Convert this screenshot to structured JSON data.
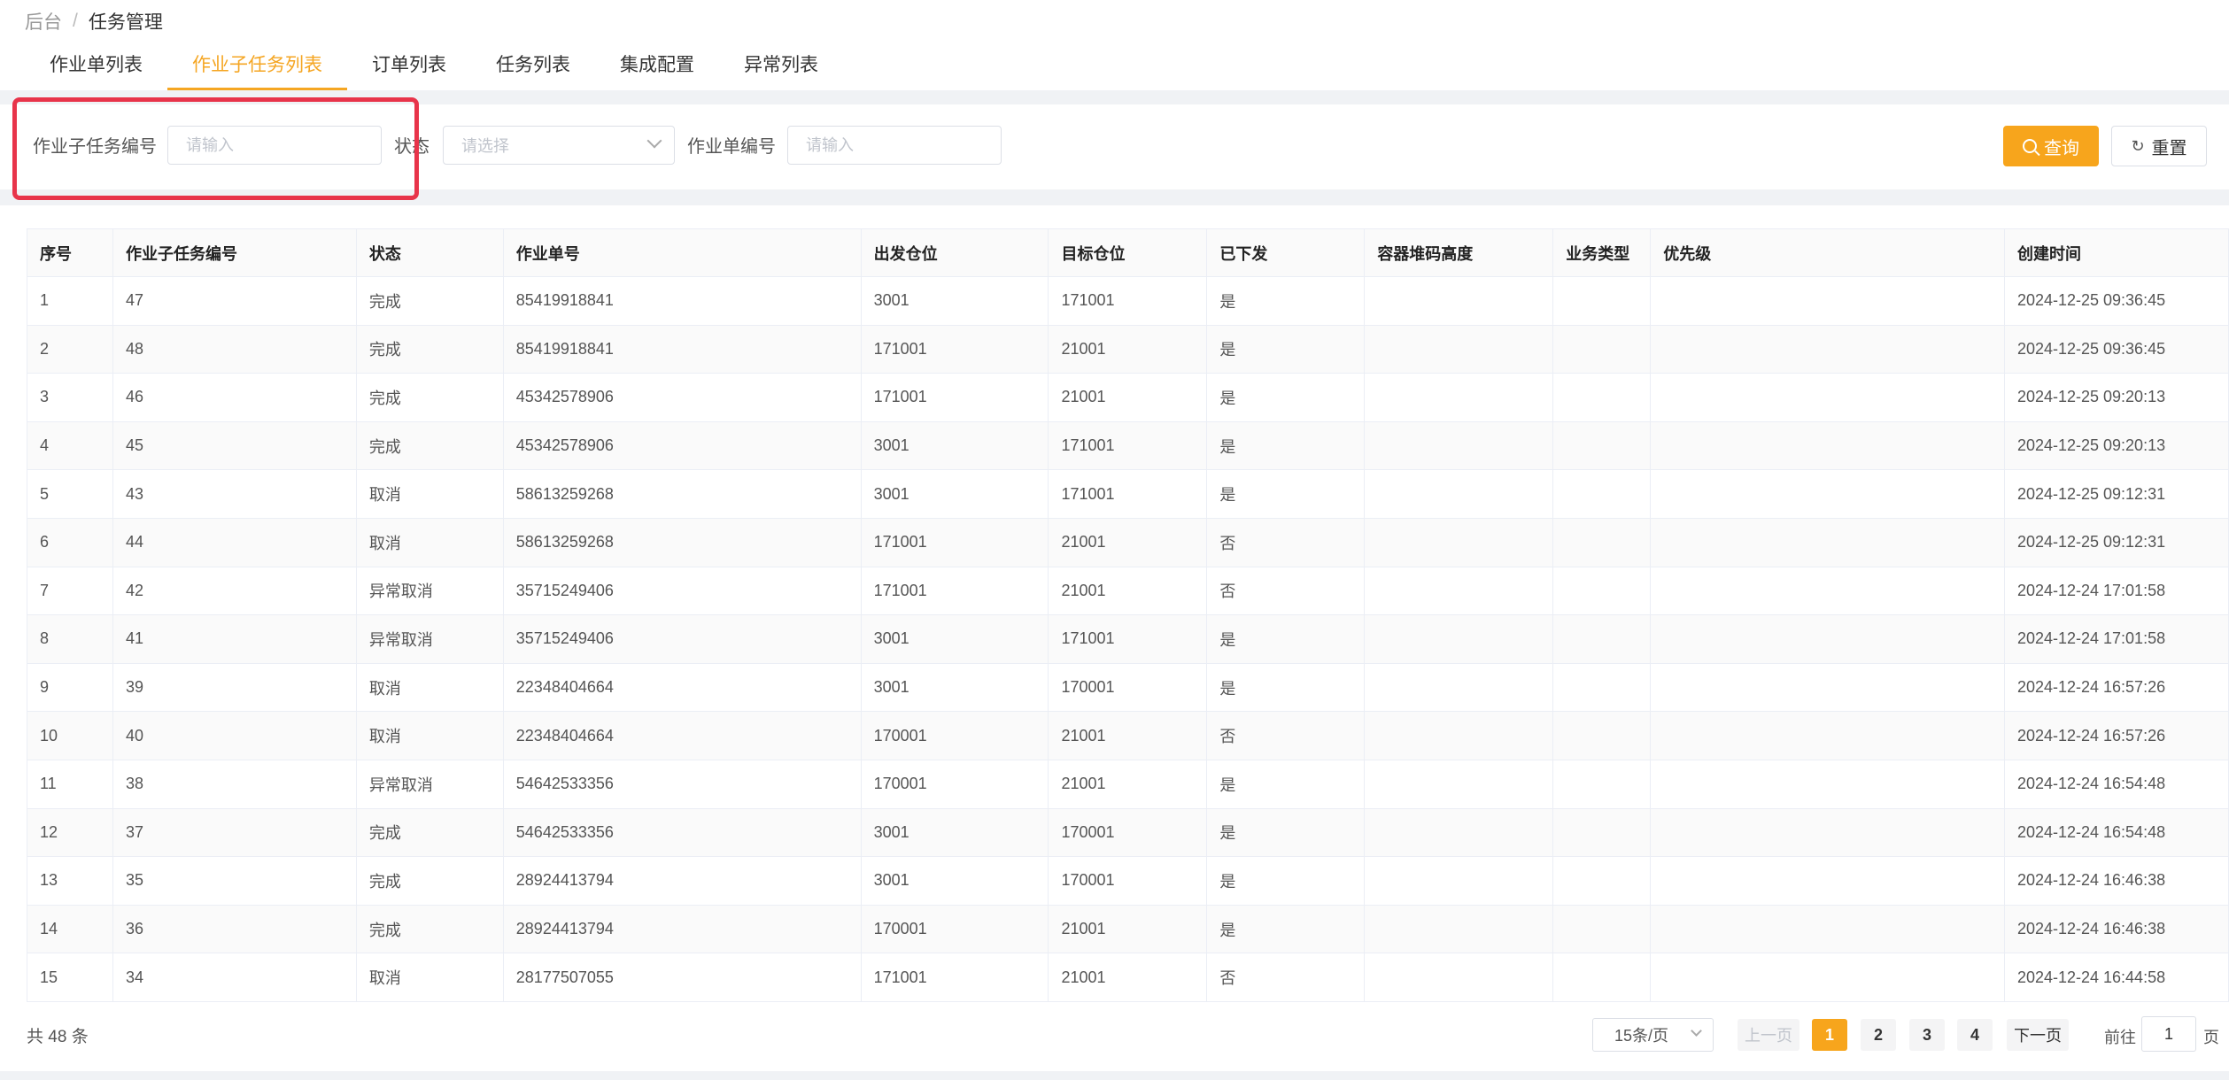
{
  "breadcrumb": {
    "root": "后台",
    "separator": "/",
    "current": "任务管理"
  },
  "tabs": [
    {
      "label": "作业单列表",
      "active": false
    },
    {
      "label": "作业子任务列表",
      "active": true
    },
    {
      "label": "订单列表",
      "active": false
    },
    {
      "label": "任务列表",
      "active": false
    },
    {
      "label": "集成配置",
      "active": false
    },
    {
      "label": "异常列表",
      "active": false
    }
  ],
  "filters": {
    "subtask_no_label": "作业子任务编号",
    "subtask_no_placeholder": "请输入",
    "status_label": "状态",
    "status_placeholder": "请选择",
    "order_no_label": "作业单编号",
    "order_no_placeholder": "请输入",
    "search_label": "查询",
    "reset_label": "重置",
    "reset_icon": "↻"
  },
  "table": {
    "headers": [
      "序号",
      "作业子任务编号",
      "状态",
      "作业单号",
      "出发仓位",
      "目标仓位",
      "已下发",
      "容器堆码高度",
      "业务类型",
      "优先级",
      "创建时间"
    ],
    "rows": [
      [
        "1",
        "47",
        "完成",
        "85419918841",
        "3001",
        "171001",
        "是",
        "",
        "",
        "",
        "2024-12-25 09:36:45"
      ],
      [
        "2",
        "48",
        "完成",
        "85419918841",
        "171001",
        "21001",
        "是",
        "",
        "",
        "",
        "2024-12-25 09:36:45"
      ],
      [
        "3",
        "46",
        "完成",
        "45342578906",
        "171001",
        "21001",
        "是",
        "",
        "",
        "",
        "2024-12-25 09:20:13"
      ],
      [
        "4",
        "45",
        "完成",
        "45342578906",
        "3001",
        "171001",
        "是",
        "",
        "",
        "",
        "2024-12-25 09:20:13"
      ],
      [
        "5",
        "43",
        "取消",
        "58613259268",
        "3001",
        "171001",
        "是",
        "",
        "",
        "",
        "2024-12-25 09:12:31"
      ],
      [
        "6",
        "44",
        "取消",
        "58613259268",
        "171001",
        "21001",
        "否",
        "",
        "",
        "",
        "2024-12-25 09:12:31"
      ],
      [
        "7",
        "42",
        "异常取消",
        "35715249406",
        "171001",
        "21001",
        "否",
        "",
        "",
        "",
        "2024-12-24 17:01:58"
      ],
      [
        "8",
        "41",
        "异常取消",
        "35715249406",
        "3001",
        "171001",
        "是",
        "",
        "",
        "",
        "2024-12-24 17:01:58"
      ],
      [
        "9",
        "39",
        "取消",
        "22348404664",
        "3001",
        "170001",
        "是",
        "",
        "",
        "",
        "2024-12-24 16:57:26"
      ],
      [
        "10",
        "40",
        "取消",
        "22348404664",
        "170001",
        "21001",
        "否",
        "",
        "",
        "",
        "2024-12-24 16:57:26"
      ],
      [
        "11",
        "38",
        "异常取消",
        "54642533356",
        "170001",
        "21001",
        "是",
        "",
        "",
        "",
        "2024-12-24 16:54:48"
      ],
      [
        "12",
        "37",
        "完成",
        "54642533356",
        "3001",
        "170001",
        "是",
        "",
        "",
        "",
        "2024-12-24 16:54:48"
      ],
      [
        "13",
        "35",
        "完成",
        "28924413794",
        "3001",
        "170001",
        "是",
        "",
        "",
        "",
        "2024-12-24 16:46:38"
      ],
      [
        "14",
        "36",
        "完成",
        "28924413794",
        "170001",
        "21001",
        "是",
        "",
        "",
        "",
        "2024-12-24 16:46:38"
      ],
      [
        "15",
        "34",
        "取消",
        "28177507055",
        "171001",
        "21001",
        "否",
        "",
        "",
        "",
        "2024-12-24 16:44:58"
      ]
    ]
  },
  "pagination": {
    "total_text": "共 48 条",
    "page_size": "15条/页",
    "prev_label": "上一页",
    "next_label": "下一页",
    "pages": [
      "1",
      "2",
      "3",
      "4"
    ],
    "current_page": "1",
    "goto_prefix": "前往",
    "goto_value": "1",
    "goto_suffix": "页"
  },
  "colors": {
    "accent": "#f7a51c",
    "highlight_border": "#e8344a"
  }
}
